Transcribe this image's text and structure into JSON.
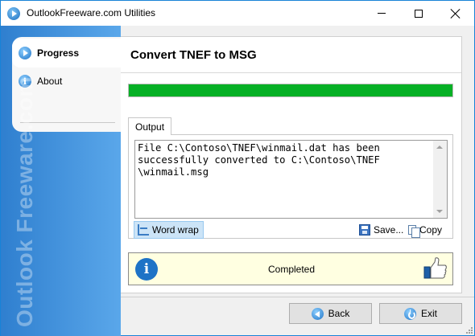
{
  "window": {
    "title": "OutlookFreeware.com Utilities",
    "icon": "app-play-icon"
  },
  "sidebar": {
    "items": [
      {
        "label": "Progress",
        "icon": "progress-icon",
        "active": true
      },
      {
        "label": "About",
        "icon": "info-icon",
        "active": false
      }
    ],
    "watermark": "Outlook Freeware.com"
  },
  "main": {
    "title": "Convert TNEF to MSG",
    "progress": 1.0,
    "progress_color": "#06b025",
    "tab_label": "Output",
    "output_text": "File C:\\Contoso\\TNEF\\winmail.dat has been\nsuccessfully converted to C:\\Contoso\\TNEF\n\\winmail.msg",
    "toolbar": {
      "word_wrap_label": "Word wrap",
      "save_label": "Save...",
      "copy_label": "Copy"
    },
    "status": {
      "text": "Completed",
      "background": "#ffffe1"
    }
  },
  "buttons": {
    "back_label": "Back",
    "exit_label": "Exit"
  }
}
